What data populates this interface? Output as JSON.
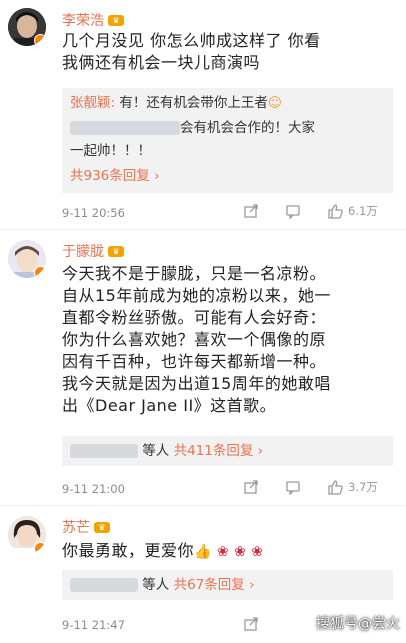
{
  "comments": [
    {
      "user": "李荣浩",
      "text_lines": [
        "几个月没见 你怎么帅成这样了 你看",
        "我俩还有机会一块儿商演吗"
      ],
      "reply_name": "张靓颖:",
      "reply_text": " 有！还有机会带你上王者",
      "reply_text2": "会有机会合作的！大家",
      "reply_text3": "一起帅！！！",
      "reply_more": "共936条回复",
      "time": "9-11 20:56",
      "likes": "6.1万"
    },
    {
      "user": "于朦胧",
      "text_lines": [
        "今天我不是于朦胧，只是一名凉粉。",
        "自从15年前成为她的凉粉以来，她一",
        "直都令粉丝骄傲。可能有人会好奇：",
        "你为什么喜欢她？喜欢一个偶像的原",
        "因有千百种，也许每天都新增一种。",
        "我今天就是因为出道15周年的她敢唱",
        "出《Dear Jane II》这首歌。"
      ],
      "reply_suffix": "等人",
      "reply_more": "共411条回复",
      "time": "9-11 21:00",
      "likes": "3.7万"
    },
    {
      "user": "苏芒",
      "text_line": "你最勇敢，更爱你",
      "reply_suffix": "等人",
      "reply_more": "共67条回复",
      "time": "9-11 21:47"
    }
  ],
  "watermark": "搜狐号@尝火",
  "icons": {
    "crown": "crown-badge",
    "verified": "verified-badge",
    "share": "share-icon",
    "comment": "comment-icon",
    "like": "thumbs-up-icon"
  },
  "colors": {
    "name": "#eb7350",
    "reply_bg": "#f2f2f2",
    "verified": "#ff8200"
  }
}
